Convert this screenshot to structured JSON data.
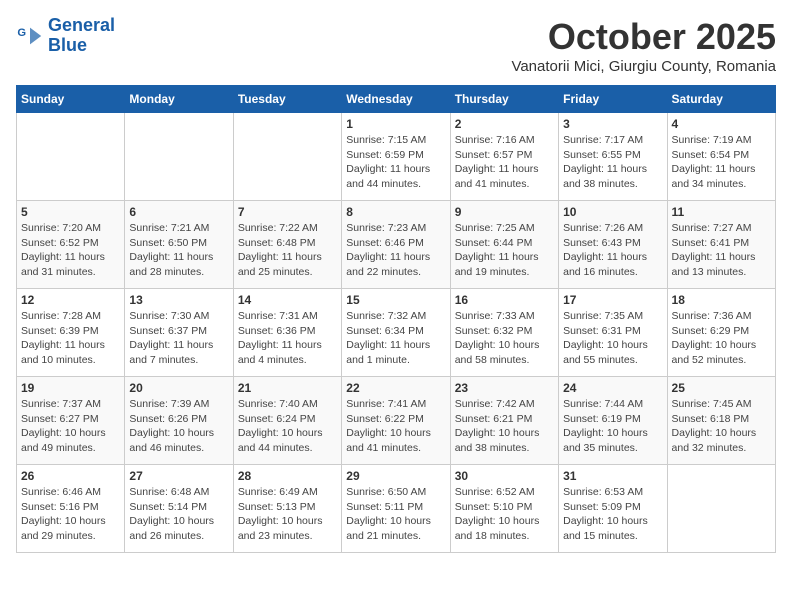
{
  "header": {
    "logo_line1": "General",
    "logo_line2": "Blue",
    "month_title": "October 2025",
    "subtitle": "Vanatorii Mici, Giurgiu County, Romania"
  },
  "weekdays": [
    "Sunday",
    "Monday",
    "Tuesday",
    "Wednesday",
    "Thursday",
    "Friday",
    "Saturday"
  ],
  "weeks": [
    [
      {
        "day": "",
        "info": ""
      },
      {
        "day": "",
        "info": ""
      },
      {
        "day": "",
        "info": ""
      },
      {
        "day": "1",
        "info": "Sunrise: 7:15 AM\nSunset: 6:59 PM\nDaylight: 11 hours\nand 44 minutes."
      },
      {
        "day": "2",
        "info": "Sunrise: 7:16 AM\nSunset: 6:57 PM\nDaylight: 11 hours\nand 41 minutes."
      },
      {
        "day": "3",
        "info": "Sunrise: 7:17 AM\nSunset: 6:55 PM\nDaylight: 11 hours\nand 38 minutes."
      },
      {
        "day": "4",
        "info": "Sunrise: 7:19 AM\nSunset: 6:54 PM\nDaylight: 11 hours\nand 34 minutes."
      }
    ],
    [
      {
        "day": "5",
        "info": "Sunrise: 7:20 AM\nSunset: 6:52 PM\nDaylight: 11 hours\nand 31 minutes."
      },
      {
        "day": "6",
        "info": "Sunrise: 7:21 AM\nSunset: 6:50 PM\nDaylight: 11 hours\nand 28 minutes."
      },
      {
        "day": "7",
        "info": "Sunrise: 7:22 AM\nSunset: 6:48 PM\nDaylight: 11 hours\nand 25 minutes."
      },
      {
        "day": "8",
        "info": "Sunrise: 7:23 AM\nSunset: 6:46 PM\nDaylight: 11 hours\nand 22 minutes."
      },
      {
        "day": "9",
        "info": "Sunrise: 7:25 AM\nSunset: 6:44 PM\nDaylight: 11 hours\nand 19 minutes."
      },
      {
        "day": "10",
        "info": "Sunrise: 7:26 AM\nSunset: 6:43 PM\nDaylight: 11 hours\nand 16 minutes."
      },
      {
        "day": "11",
        "info": "Sunrise: 7:27 AM\nSunset: 6:41 PM\nDaylight: 11 hours\nand 13 minutes."
      }
    ],
    [
      {
        "day": "12",
        "info": "Sunrise: 7:28 AM\nSunset: 6:39 PM\nDaylight: 11 hours\nand 10 minutes."
      },
      {
        "day": "13",
        "info": "Sunrise: 7:30 AM\nSunset: 6:37 PM\nDaylight: 11 hours\nand 7 minutes."
      },
      {
        "day": "14",
        "info": "Sunrise: 7:31 AM\nSunset: 6:36 PM\nDaylight: 11 hours\nand 4 minutes."
      },
      {
        "day": "15",
        "info": "Sunrise: 7:32 AM\nSunset: 6:34 PM\nDaylight: 11 hours\nand 1 minute."
      },
      {
        "day": "16",
        "info": "Sunrise: 7:33 AM\nSunset: 6:32 PM\nDaylight: 10 hours\nand 58 minutes."
      },
      {
        "day": "17",
        "info": "Sunrise: 7:35 AM\nSunset: 6:31 PM\nDaylight: 10 hours\nand 55 minutes."
      },
      {
        "day": "18",
        "info": "Sunrise: 7:36 AM\nSunset: 6:29 PM\nDaylight: 10 hours\nand 52 minutes."
      }
    ],
    [
      {
        "day": "19",
        "info": "Sunrise: 7:37 AM\nSunset: 6:27 PM\nDaylight: 10 hours\nand 49 minutes."
      },
      {
        "day": "20",
        "info": "Sunrise: 7:39 AM\nSunset: 6:26 PM\nDaylight: 10 hours\nand 46 minutes."
      },
      {
        "day": "21",
        "info": "Sunrise: 7:40 AM\nSunset: 6:24 PM\nDaylight: 10 hours\nand 44 minutes."
      },
      {
        "day": "22",
        "info": "Sunrise: 7:41 AM\nSunset: 6:22 PM\nDaylight: 10 hours\nand 41 minutes."
      },
      {
        "day": "23",
        "info": "Sunrise: 7:42 AM\nSunset: 6:21 PM\nDaylight: 10 hours\nand 38 minutes."
      },
      {
        "day": "24",
        "info": "Sunrise: 7:44 AM\nSunset: 6:19 PM\nDaylight: 10 hours\nand 35 minutes."
      },
      {
        "day": "25",
        "info": "Sunrise: 7:45 AM\nSunset: 6:18 PM\nDaylight: 10 hours\nand 32 minutes."
      }
    ],
    [
      {
        "day": "26",
        "info": "Sunrise: 6:46 AM\nSunset: 5:16 PM\nDaylight: 10 hours\nand 29 minutes."
      },
      {
        "day": "27",
        "info": "Sunrise: 6:48 AM\nSunset: 5:14 PM\nDaylight: 10 hours\nand 26 minutes."
      },
      {
        "day": "28",
        "info": "Sunrise: 6:49 AM\nSunset: 5:13 PM\nDaylight: 10 hours\nand 23 minutes."
      },
      {
        "day": "29",
        "info": "Sunrise: 6:50 AM\nSunset: 5:11 PM\nDaylight: 10 hours\nand 21 minutes."
      },
      {
        "day": "30",
        "info": "Sunrise: 6:52 AM\nSunset: 5:10 PM\nDaylight: 10 hours\nand 18 minutes."
      },
      {
        "day": "31",
        "info": "Sunrise: 6:53 AM\nSunset: 5:09 PM\nDaylight: 10 hours\nand 15 minutes."
      },
      {
        "day": "",
        "info": ""
      }
    ]
  ]
}
